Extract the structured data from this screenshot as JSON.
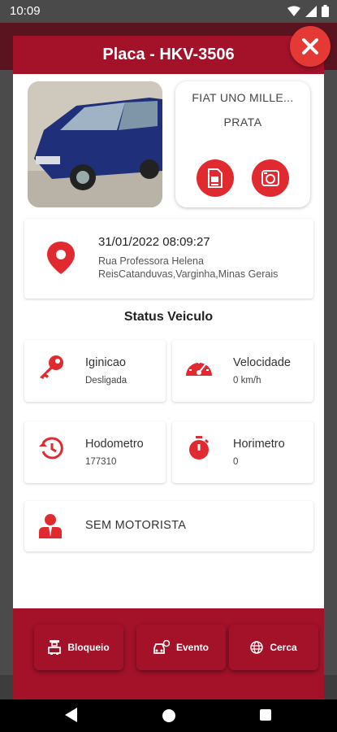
{
  "status_bar": {
    "time": "10:09"
  },
  "dialog": {
    "title": "Placa - HKV-3506",
    "vehicle": {
      "model": "FIAT UNO MILLE...",
      "color": "PRATA"
    },
    "location": {
      "datetime": "31/01/2022 08:09:27",
      "address_line1": "Rua Professora Helena",
      "address_line2": "ReisCatanduvas,Varginha,Minas Gerais"
    },
    "section_title": "Status Veiculo",
    "stats": {
      "ignition": {
        "label": "Iginicao",
        "value": "Desligada"
      },
      "speed": {
        "label": "Velocidade",
        "value": "0 km/h"
      },
      "odometer": {
        "label": "Hodometro",
        "value": "177310"
      },
      "hourmeter": {
        "label": "Horimetro",
        "value": "0"
      }
    },
    "driver": {
      "label": "SEM MOTORISTA"
    },
    "footer": {
      "block": "Bloqueio",
      "event": "Evento",
      "fence": "Cerca"
    }
  },
  "colors": {
    "brand": "#a4122a",
    "accent": "#e02a30",
    "close": "#e53935"
  },
  "icons": [
    "wifi-icon",
    "signal-icon",
    "battery-icon",
    "close-icon",
    "document-icon",
    "camera-icon",
    "location-pin-icon",
    "key-icon",
    "speedometer-icon",
    "history-icon",
    "stopwatch-icon",
    "driver-icon",
    "block-icon",
    "event-car-icon",
    "globe-icon"
  ]
}
